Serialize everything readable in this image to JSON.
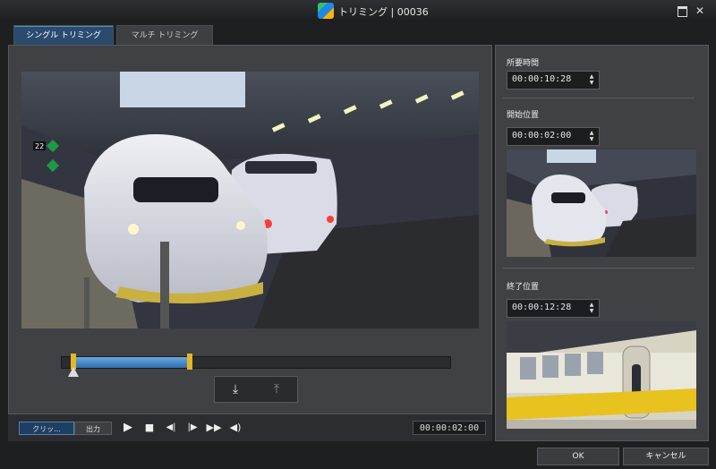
{
  "window": {
    "title": "トリミング | 00036"
  },
  "tabs": [
    {
      "label": "シングル トリミング",
      "active": true
    },
    {
      "label": "マルチ トリミング",
      "active": false
    }
  ],
  "timeline": {
    "selection_start_fraction": 0.03,
    "selection_end_fraction": 0.33,
    "playhead_fraction": 0.03
  },
  "mode_toggle": {
    "preview_label": "クリッ...",
    "output_label": "出力"
  },
  "current_time": "00:00:02:00",
  "side": {
    "duration": {
      "label": "所要時間",
      "value": "00:00:10:28"
    },
    "start": {
      "label": "開始位置",
      "value": "00:00:02:00"
    },
    "end": {
      "label": "終了位置",
      "value": "00:00:12:28"
    }
  },
  "buttons": {
    "ok": "OK",
    "cancel": "キャンセル"
  },
  "colors": {
    "accent": "#2d6fae",
    "marker": "#e6b623"
  }
}
